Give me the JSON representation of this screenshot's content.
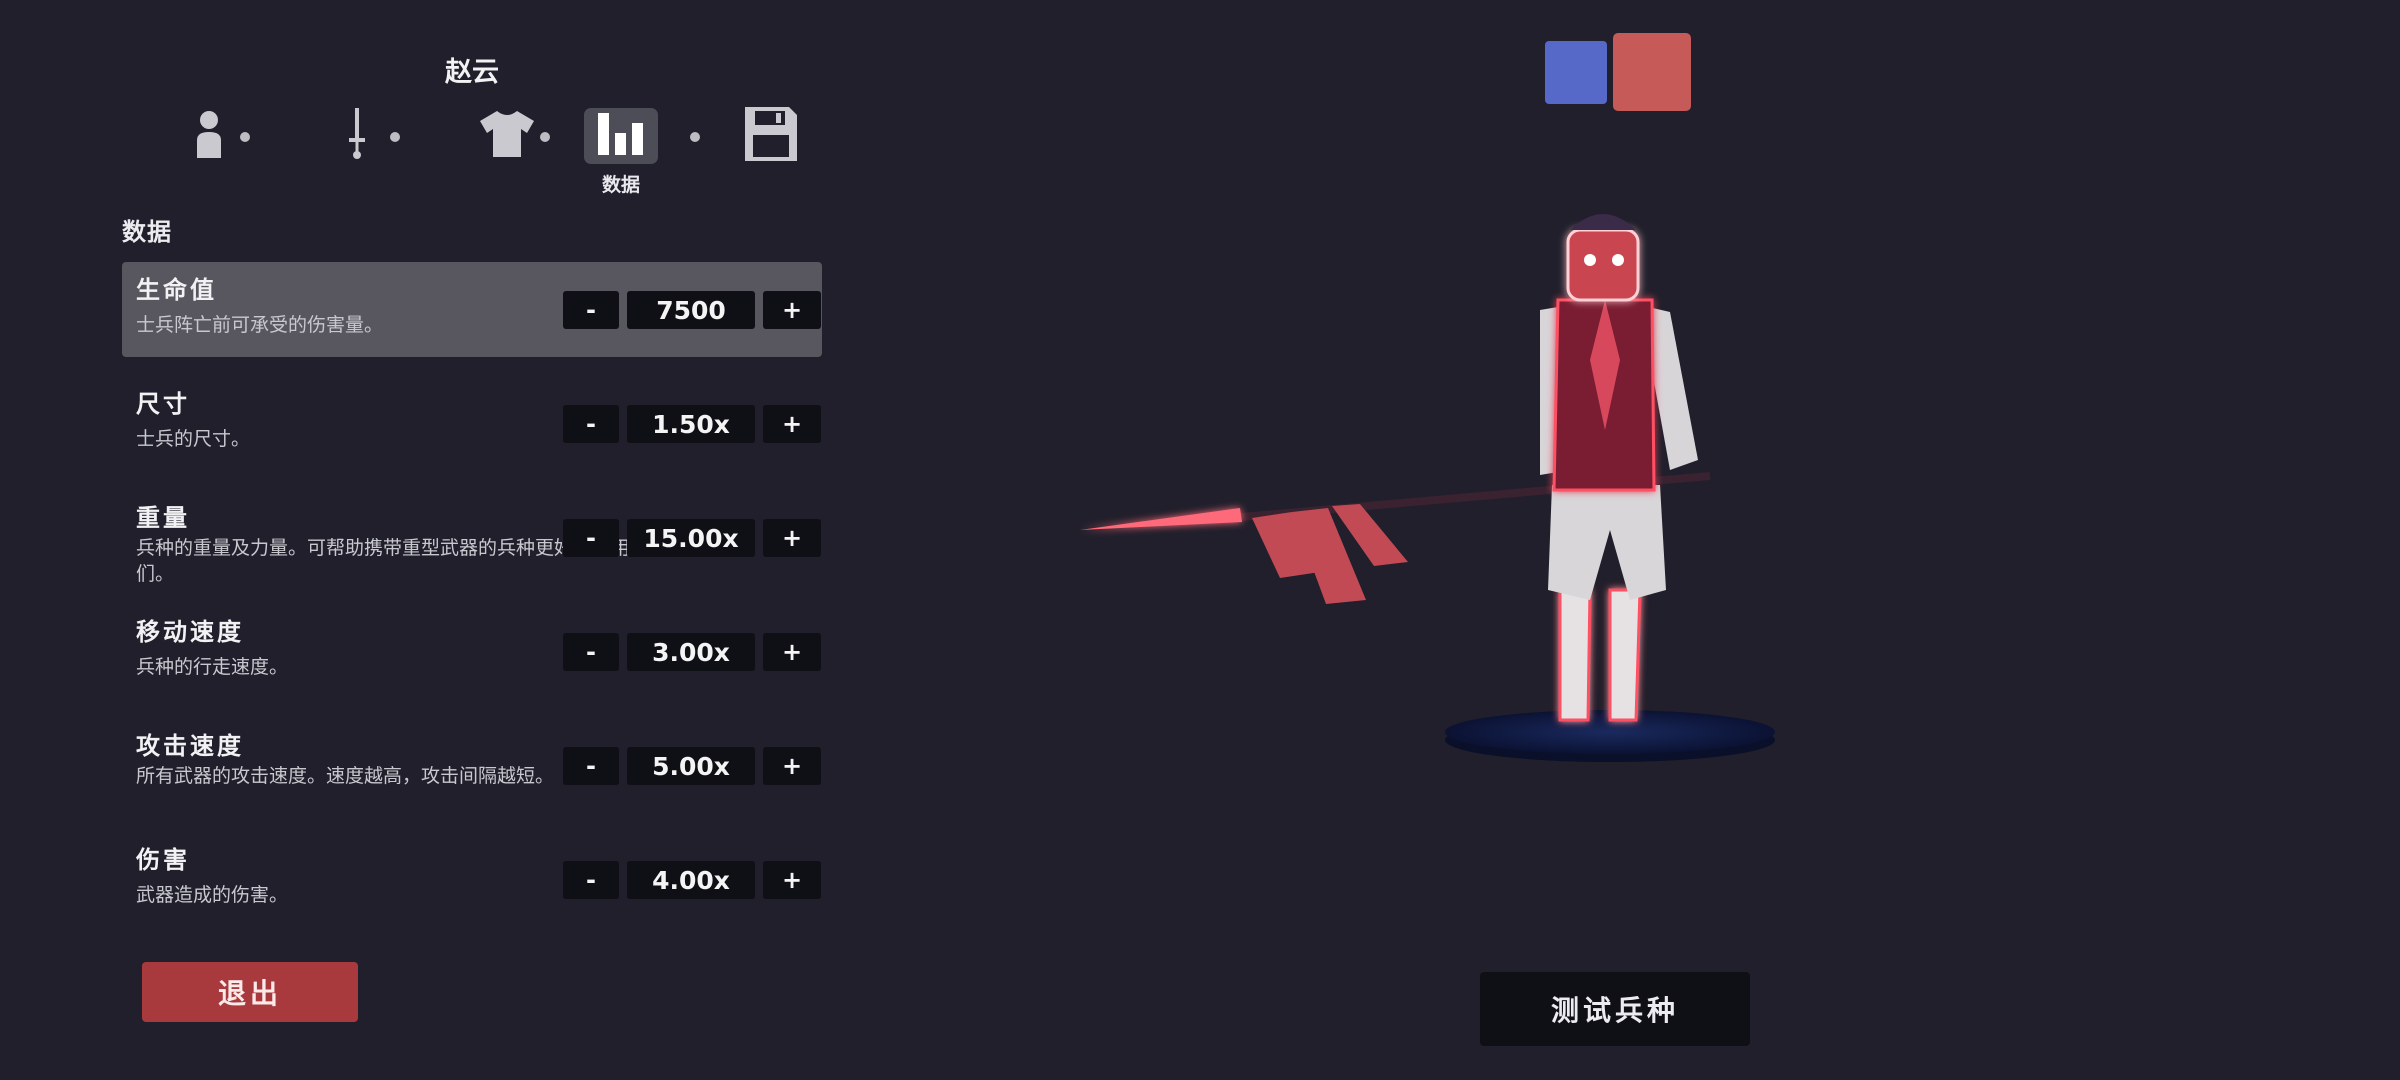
{
  "unit": {
    "name": "赵云"
  },
  "tabs": [
    {
      "icon": "person-icon",
      "label": ""
    },
    {
      "icon": "sword-icon",
      "label": ""
    },
    {
      "icon": "shirt-icon",
      "label": ""
    },
    {
      "icon": "stats-chart-icon",
      "label": "数据",
      "active": true
    },
    {
      "icon": "save-icon",
      "label": ""
    }
  ],
  "section": {
    "title": "数据"
  },
  "stats": [
    {
      "name": "生命值",
      "description": "士兵阵亡前可承受的伤害量。",
      "value": "7500",
      "selected": true
    },
    {
      "name": "尺寸",
      "description": "士兵的尺寸。",
      "value": "1.50x"
    },
    {
      "name": "重量",
      "description": "兵种的重量及力量。可帮助携带重型武器的兵种更好地使用它们。",
      "value": "15.00x"
    },
    {
      "name": "移动速度",
      "description": "兵种的行走速度。",
      "value": "3.00x"
    },
    {
      "name": "攻击速度",
      "description": "所有武器的攻击速度。速度越高，攻击间隔越短。",
      "value": "5.00x"
    },
    {
      "name": "伤害",
      "description": "武器造成的伤害。",
      "value": "4.00x"
    }
  ],
  "stepper": {
    "minus": "-",
    "plus": "+"
  },
  "buttons": {
    "exit": "退出",
    "test": "测试兵种"
  },
  "teams": {
    "blue": "#5769c8",
    "red": "#c55a58",
    "selected": "red"
  }
}
